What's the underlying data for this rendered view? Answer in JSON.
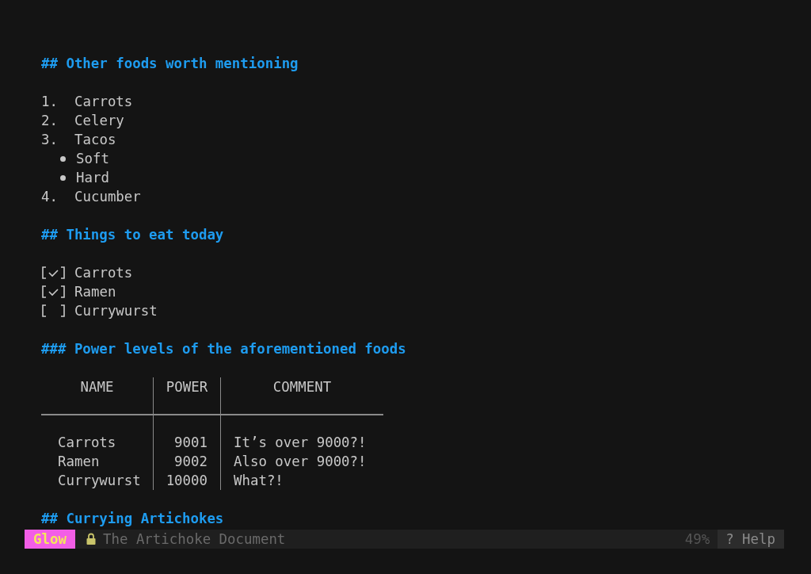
{
  "document": [
    {
      "kind": "heading",
      "text": "## Other foods worth mentioning"
    },
    {
      "kind": "ordered_list",
      "items": [
        {
          "number": "1.",
          "text": "Carrots"
        },
        {
          "number": "2.",
          "text": "Celery"
        },
        {
          "number": "3.",
          "text": "Tacos",
          "children": [
            {
              "text": "Soft"
            },
            {
              "text": "Hard"
            }
          ]
        },
        {
          "number": "4.",
          "text": "Cucumber"
        }
      ]
    },
    {
      "kind": "heading",
      "text": "## Things to eat today"
    },
    {
      "kind": "task_list",
      "items": [
        {
          "text": "Carrots",
          "checked": true
        },
        {
          "text": "Ramen",
          "checked": true
        },
        {
          "text": "Currywurst",
          "checked": false
        }
      ]
    },
    {
      "kind": "heading",
      "text": "### Power levels of the aforementioned foods"
    },
    {
      "kind": "table",
      "columns": [
        "NAME",
        "POWER",
        "COMMENT"
      ],
      "rows": [
        [
          "Carrots",
          "9001",
          "It’s over 9000?!"
        ],
        [
          "Ramen",
          "9002",
          "Also over 9000?!"
        ],
        [
          "Currywurst",
          "10000",
          "What?!"
        ]
      ]
    },
    {
      "kind": "heading",
      "text": "## Currying Artichokes"
    }
  ],
  "status_bar": {
    "app": "Glow",
    "title": "The Artichoke Document",
    "percent": "49%",
    "help": "? Help"
  }
}
